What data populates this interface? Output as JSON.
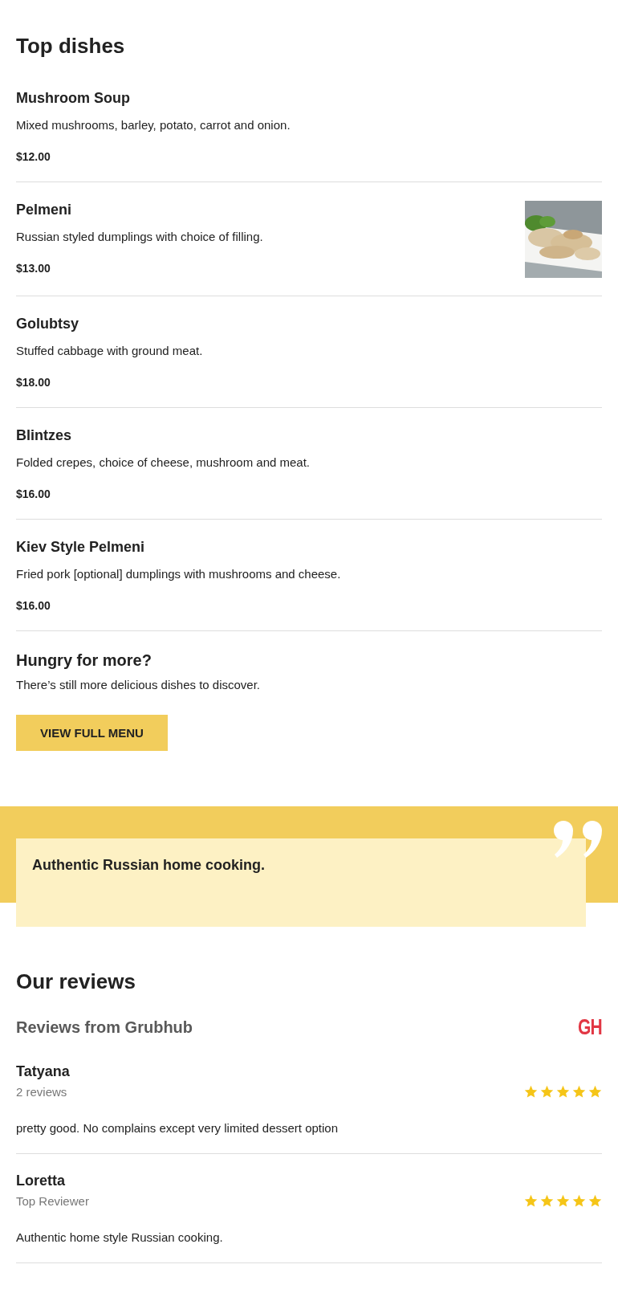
{
  "top_dishes": {
    "title": "Top dishes",
    "dishes": [
      {
        "name": "Mushroom Soup",
        "description": "Mixed mushrooms, barley, potato, carrot and onion.",
        "price": "$12.00"
      },
      {
        "name": "Pelmeni",
        "description": "Russian styled dumplings with choice of filling.",
        "price": "$13.00"
      },
      {
        "name": "Golubtsy",
        "description": "Stuffed cabbage with ground meat.",
        "price": "$18.00"
      },
      {
        "name": "Blintzes",
        "description": "Folded crepes, choice of cheese, mushroom and meat.",
        "price": "$16.00"
      },
      {
        "name": "Kiev Style Pelmeni",
        "description": "Fried pork [optional] dumplings with mushrooms and cheese.",
        "price": "$16.00"
      }
    ]
  },
  "more": {
    "title": "Hungry for more?",
    "text": "There’s still more delicious dishes to discover.",
    "button": "VIEW FULL MENU"
  },
  "quote": {
    "text": "Authentic Russian home cooking."
  },
  "reviews": {
    "title": "Our reviews",
    "source": "Reviews from Grubhub",
    "logo_text": "GH",
    "items": [
      {
        "name": "Tatyana",
        "subtitle": "2 reviews",
        "stars": 5,
        "text": "pretty good. No complains except very limited dessert option"
      },
      {
        "name": "Loretta",
        "subtitle": "Top Reviewer",
        "stars": 5,
        "text": "Authentic home style Russian cooking."
      }
    ]
  }
}
